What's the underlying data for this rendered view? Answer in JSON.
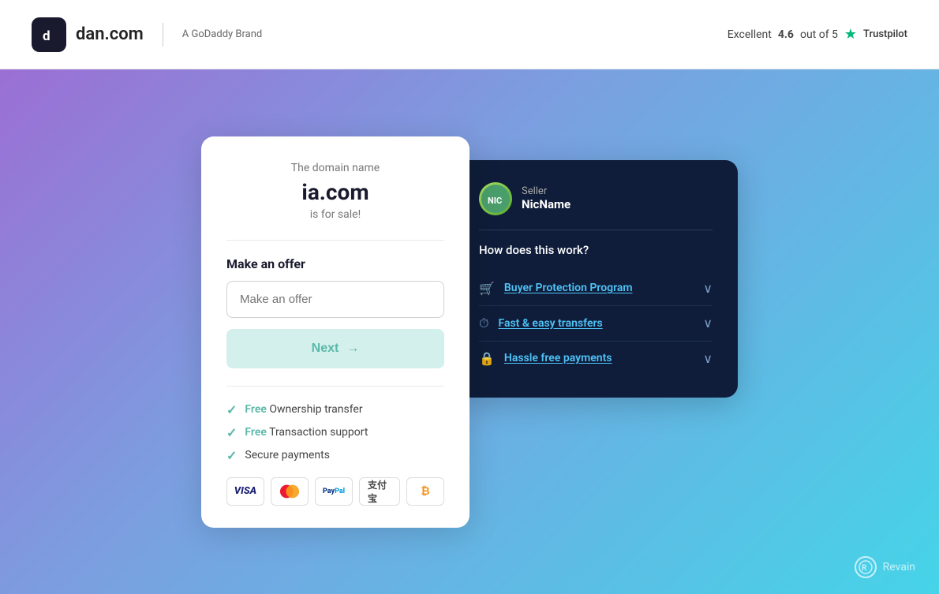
{
  "header": {
    "logo_icon_text": "d",
    "logo_text": "dan.com",
    "brand_text": "A GoDaddy Brand",
    "trustpilot": {
      "prefix": "Excellent",
      "score": "4.6",
      "out_of_text": "out of 5",
      "logo_text": "Trustpilot"
    }
  },
  "domain_card": {
    "label": "The domain name",
    "domain": "ia.com",
    "forsale": "is for sale!",
    "offer_label": "Make an offer",
    "offer_placeholder": "Make an offer",
    "next_button_label": "Next",
    "benefits": [
      {
        "free": "Free",
        "text": " Ownership transfer"
      },
      {
        "free": "Free",
        "text": " Transaction support"
      },
      {
        "free": "",
        "text": "Secure payments"
      }
    ],
    "payment_icons": [
      {
        "label": "VISA",
        "type": "visa"
      },
      {
        "label": "●●",
        "type": "mastercard"
      },
      {
        "label": "PayPal",
        "type": "paypal"
      },
      {
        "label": "支付宝",
        "type": "alipay"
      },
      {
        "label": "₿",
        "type": "btc"
      }
    ]
  },
  "seller_card": {
    "seller_label": "Seller",
    "seller_name": "NicName",
    "how_title": "How does this work?",
    "features": [
      {
        "icon": "🛒",
        "text": "Buyer Protection Program",
        "has_chevron": true
      },
      {
        "icon": "⏱",
        "text": "Fast & easy transfers",
        "has_chevron": true
      },
      {
        "icon": "🔒",
        "text": "Hassle free payments",
        "has_chevron": true
      }
    ]
  },
  "revain": {
    "icon": "R",
    "label": "Revain"
  }
}
